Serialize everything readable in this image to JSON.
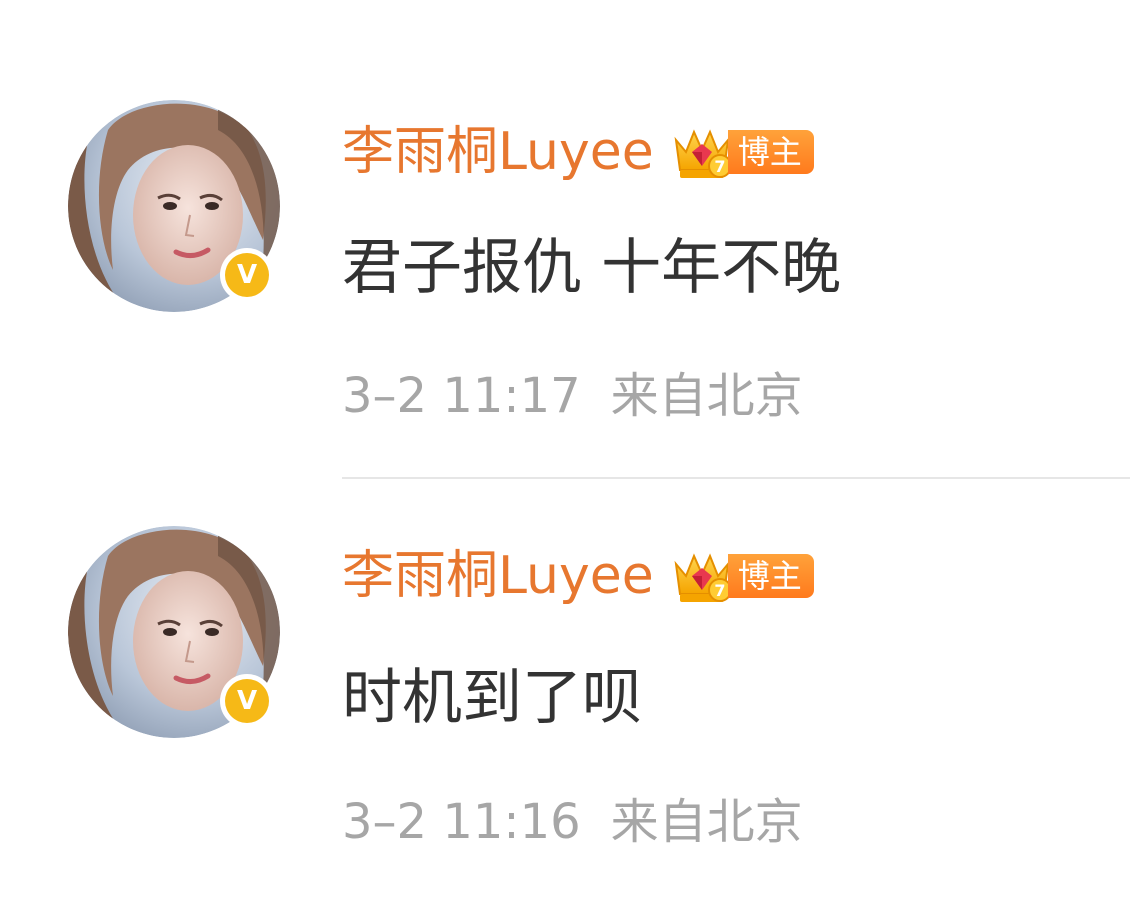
{
  "comments": [
    {
      "username": "李雨桐Luyee",
      "badge_label": "博主",
      "badge_level": "7",
      "verified_mark": "V",
      "text": "君子报仇 十年不晚",
      "time": "3–2 11:17",
      "location": "来自北京"
    },
    {
      "username": "李雨桐Luyee",
      "badge_label": "博主",
      "badge_level": "7",
      "verified_mark": "V",
      "text": "时机到了呗",
      "time": "3–2 11:16",
      "location": "来自北京"
    }
  ],
  "colors": {
    "username": "#e7772f",
    "verified": "#f6b917",
    "badge": "#ff8a25",
    "meta": "#a6a6a6",
    "text": "#333333"
  },
  "icons": {
    "avatar": "profile-photo",
    "verified": "verified-v-icon",
    "badge": "crown-level-icon"
  }
}
